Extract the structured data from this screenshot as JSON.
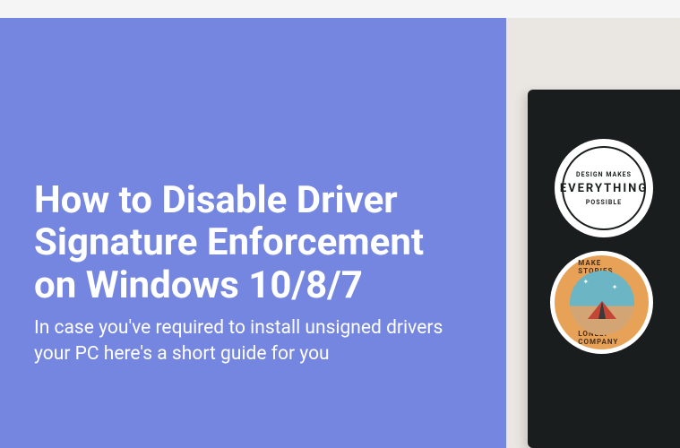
{
  "overlay": {
    "title": "How to Disable Driver Signature Enforcement on Windows 10/8/7",
    "subtitle": "In case you've required to install unsigned drivers your PC here's a short guide for you"
  },
  "stickers": {
    "everything": {
      "top": "DESIGN MAKES",
      "main": "EVERYTHING",
      "bottom": "POSSIBLE"
    },
    "stories": {
      "top": "MAKE STORIES",
      "bottom": "LONELY COMPANY"
    }
  }
}
